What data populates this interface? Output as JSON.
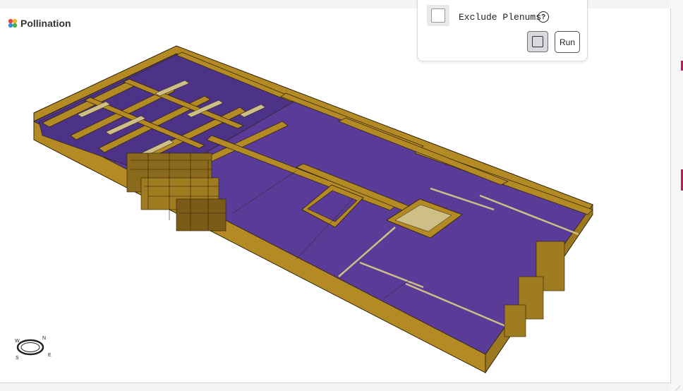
{
  "logo": {
    "text": "Pollination"
  },
  "panel": {
    "exclude_label": "Exclude Plenums",
    "help_glyph": "?",
    "run_label": "Run"
  },
  "compass": {
    "n": "N",
    "s": "S",
    "e": "E",
    "w": "W"
  },
  "colors": {
    "floor": "#5a3c98",
    "wall": "#b38a24",
    "wall_light": "#cdbf86",
    "edge": "#2a1f05"
  },
  "icons": [
    "logo-petals-icon",
    "help-icon",
    "compass-icon",
    "toggle-square-icon"
  ]
}
